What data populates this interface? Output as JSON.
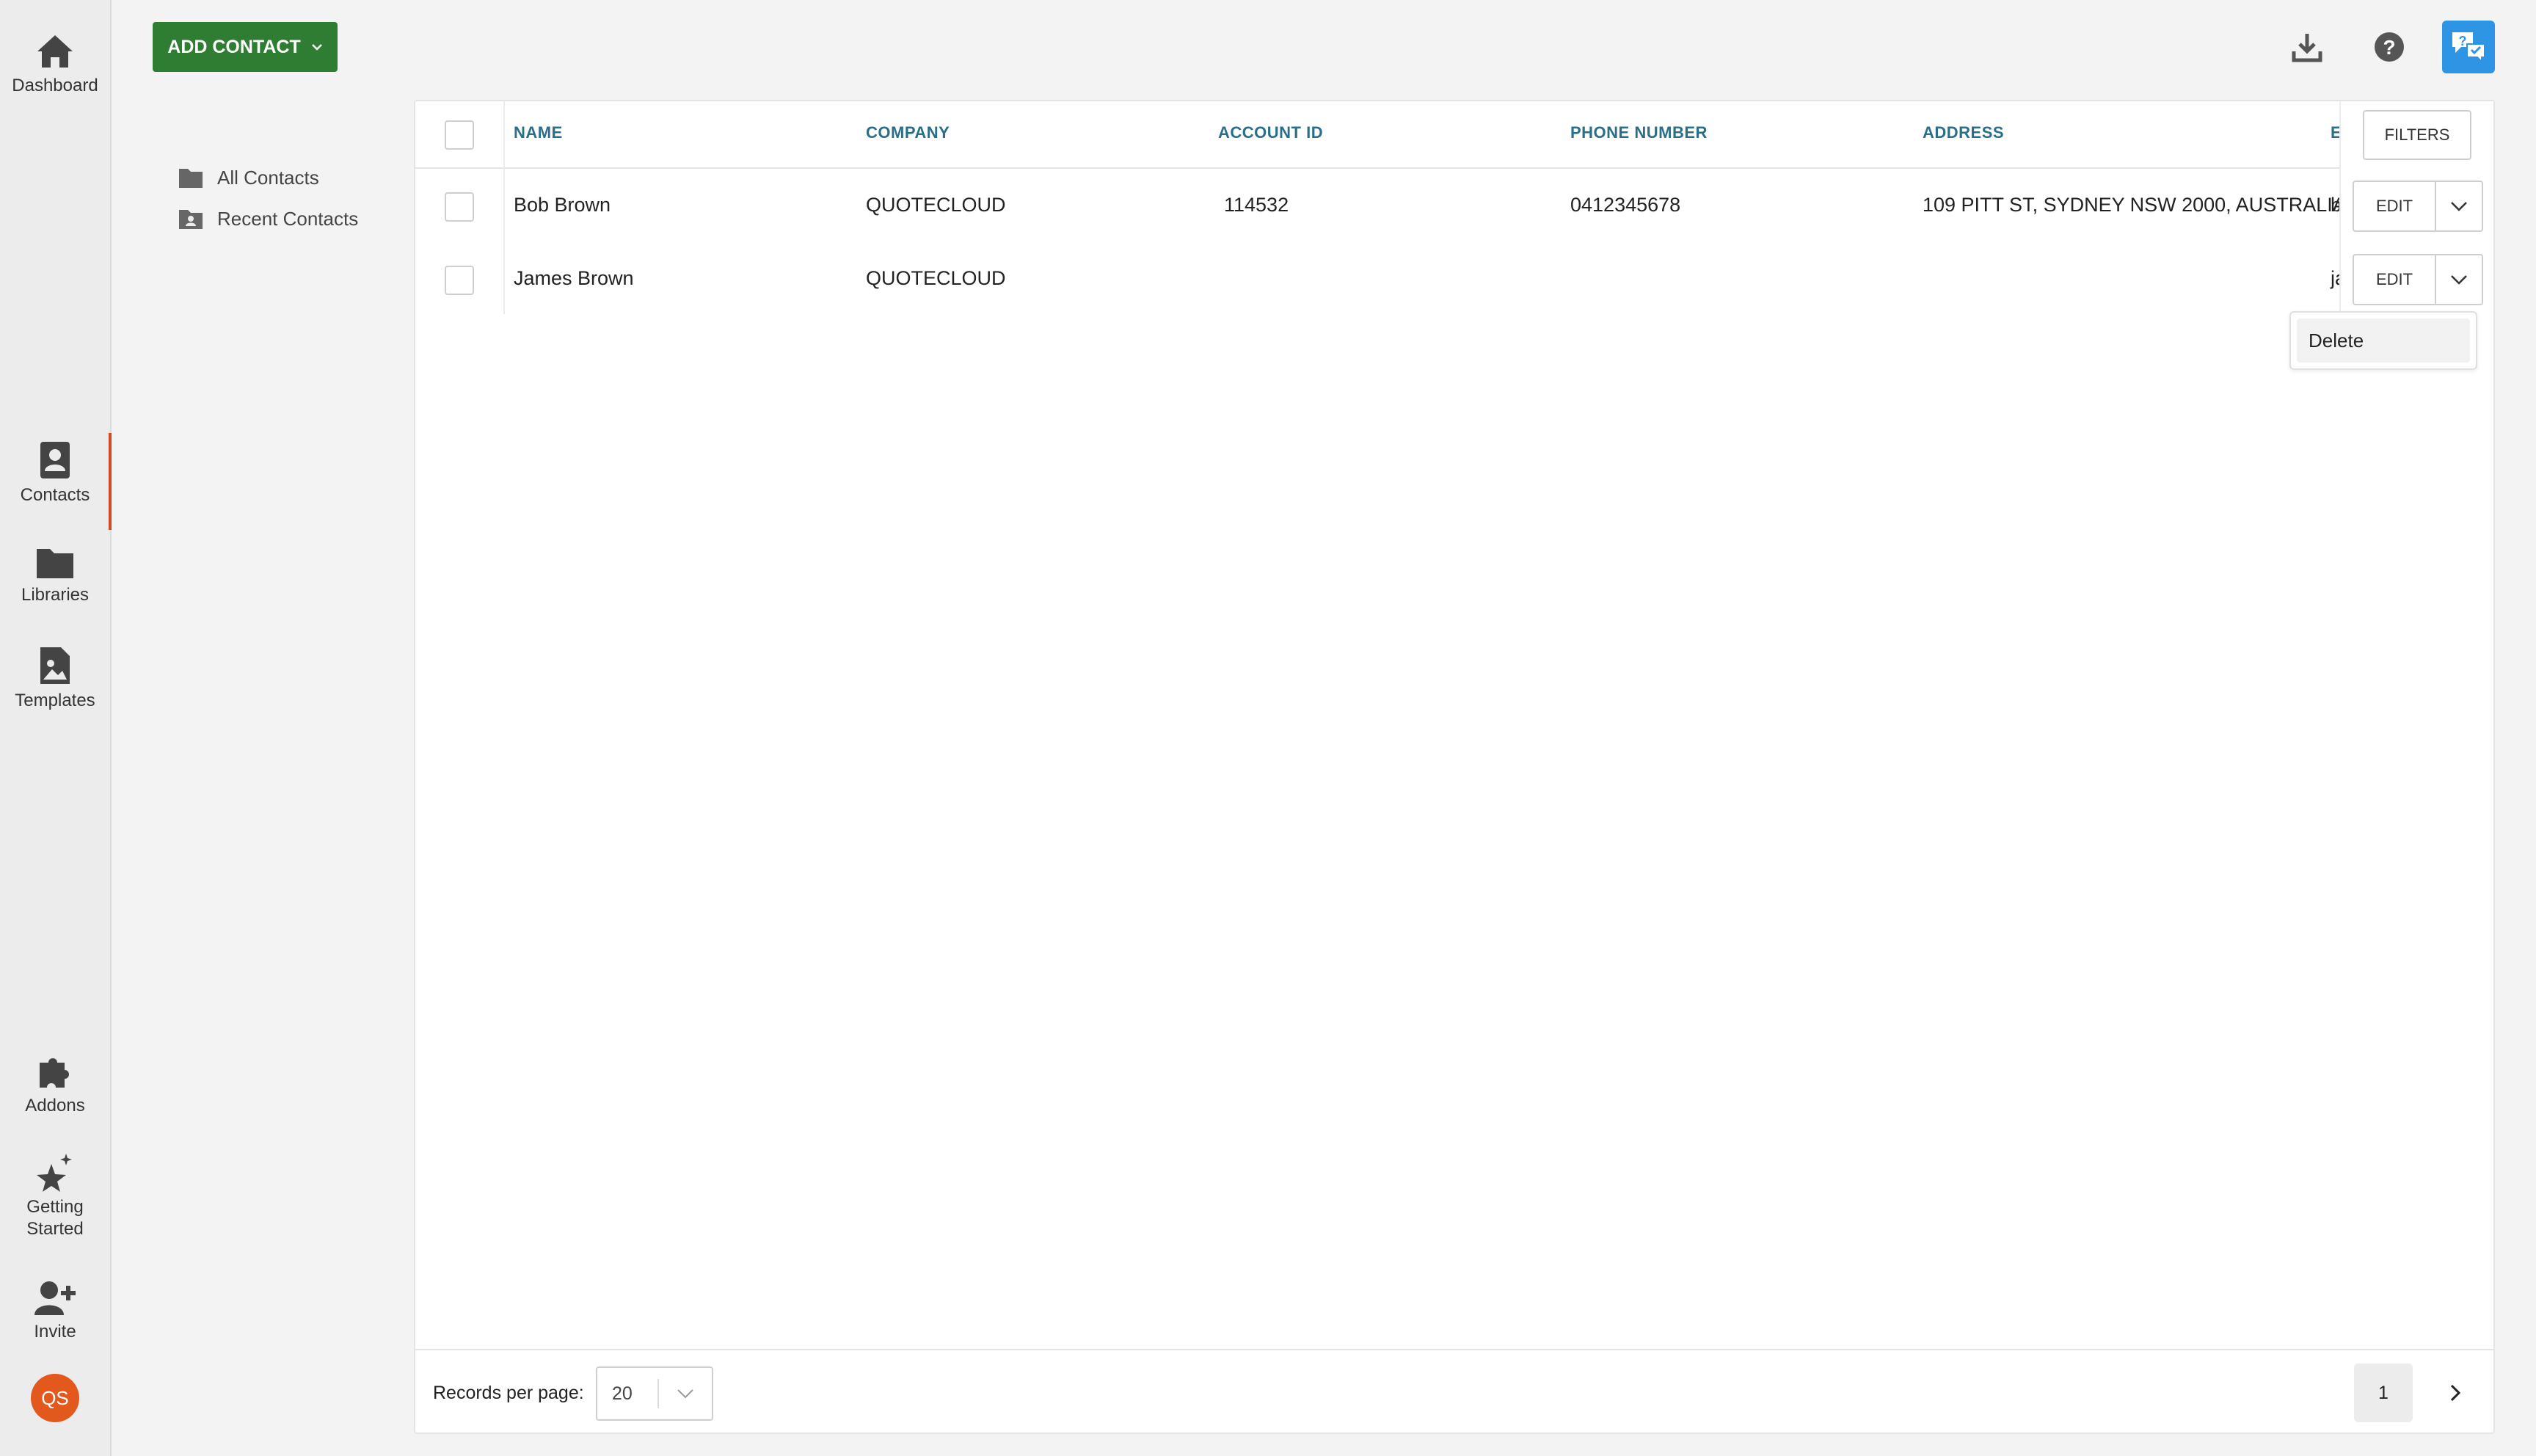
{
  "sidebar": {
    "top_items": [
      {
        "label": "Dashboard",
        "icon": "home-icon"
      }
    ],
    "middle_items": [
      {
        "label": "Contacts",
        "icon": "contact-card-icon",
        "active": true
      },
      {
        "label": "Libraries",
        "icon": "folder-icon"
      },
      {
        "label": "Templates",
        "icon": "image-file-icon"
      }
    ],
    "bottom_items": [
      {
        "label": "Addons",
        "icon": "puzzle-icon"
      },
      {
        "label": "Getting Started",
        "icon": "sparkle-star-icon"
      },
      {
        "label": "Invite",
        "icon": "add-user-icon"
      }
    ],
    "avatar_initials": "QS",
    "accent_color": "#d24a1e",
    "avatar_color": "#e2581d"
  },
  "toolbar": {
    "add_contact_label": "ADD CONTACT",
    "add_contact_color": "#2e7d32",
    "chat_color": "#2d95e3"
  },
  "folders": [
    {
      "label": "All Contacts",
      "icon": "folder-icon"
    },
    {
      "label": "Recent Contacts",
      "icon": "folder-user-icon"
    }
  ],
  "table": {
    "columns": [
      "NAME",
      "COMPANY",
      "ACCOUNT ID",
      "PHONE NUMBER",
      "ADDRESS",
      "E"
    ],
    "rows": [
      {
        "name": "Bob Brown",
        "company": "QUOTECLOUD",
        "account_id": "114532",
        "phone": "0412345678",
        "address": "109 PITT ST, SYDNEY NSW 2000, AUSTRALIA",
        "email_partial": "b"
      },
      {
        "name": "James Brown",
        "company": "QUOTECLOUD",
        "account_id": "",
        "phone": "",
        "address": "",
        "email_partial": "ja"
      }
    ],
    "filters_label": "FILTERS",
    "edit_label": "EDIT",
    "dropdown_items": [
      "Delete"
    ],
    "header_color": "#2a6f8a"
  },
  "pagination": {
    "records_label": "Records per page:",
    "records_value": "20",
    "current_page": "1"
  }
}
